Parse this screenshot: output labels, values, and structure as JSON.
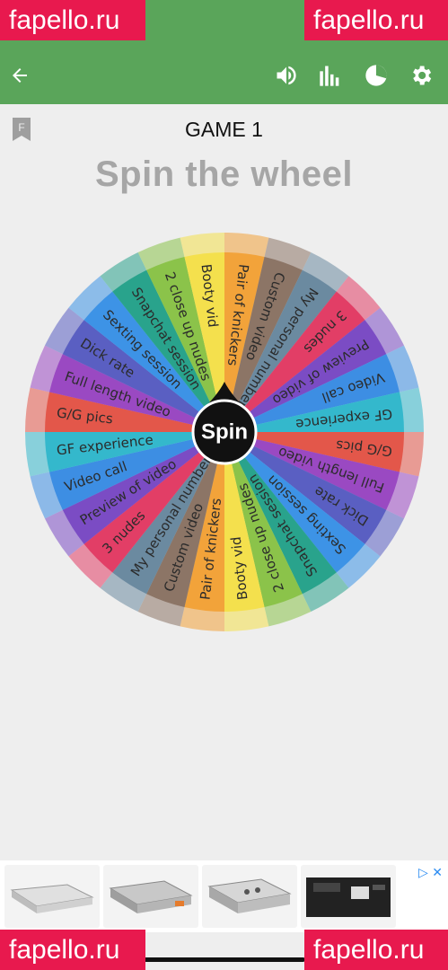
{
  "watermarks": {
    "text": "fapello.ru"
  },
  "toolbar": {
    "icons": [
      "back-arrow-icon",
      "speaker-icon",
      "bar-chart-icon",
      "pie-chart-icon",
      "gear-icon"
    ],
    "accent_color": "#5aa55a"
  },
  "game": {
    "title": "GAME 1",
    "heading": "Spin the wheel"
  },
  "wheel": {
    "center_label": "Spin",
    "segments": [
      {
        "label": "Pair of knickers",
        "color": "#f2a33a"
      },
      {
        "label": "Custom video",
        "color": "#8c7566"
      },
      {
        "label": "My personal number",
        "color": "#6b8aa0"
      },
      {
        "label": "3 nudes",
        "color": "#e23e66"
      },
      {
        "label": "Preview of video",
        "color": "#7b4cc4"
      },
      {
        "label": "Video call",
        "color": "#3d8ee3"
      },
      {
        "label": "GF experience",
        "color": "#34b8cc"
      },
      {
        "label": "G/G pics",
        "color": "#e3574a"
      },
      {
        "label": "Full length video",
        "color": "#9a49c2"
      },
      {
        "label": "Dick rate",
        "color": "#5a5fc2"
      },
      {
        "label": "Sexting session",
        "color": "#3d93e6"
      },
      {
        "label": "Snapchat session",
        "color": "#29a38c"
      },
      {
        "label": "2 close up nudes",
        "color": "#8bc34a"
      },
      {
        "label": "Booty vid",
        "color": "#f4e04d"
      },
      {
        "label": "Pair of knickers",
        "color": "#f2a33a"
      },
      {
        "label": "Custom video",
        "color": "#8c7566"
      },
      {
        "label": "My personal number",
        "color": "#6b8aa0"
      },
      {
        "label": "3 nudes",
        "color": "#e23e66"
      },
      {
        "label": "Preview of video",
        "color": "#7b4cc4"
      },
      {
        "label": "Video call",
        "color": "#3d8ee3"
      },
      {
        "label": "GF experience",
        "color": "#34b8cc"
      },
      {
        "label": "G/G pics",
        "color": "#e3574a"
      },
      {
        "label": "Full length video",
        "color": "#9a49c2"
      },
      {
        "label": "Dick rate",
        "color": "#5a5fc2"
      },
      {
        "label": "Sexting session",
        "color": "#3d93e6"
      },
      {
        "label": "Snapchat session",
        "color": "#29a38c"
      },
      {
        "label": "2 close up nudes",
        "color": "#8bc34a"
      },
      {
        "label": "Booty vid",
        "color": "#f4e04d"
      }
    ]
  },
  "ad": {
    "images": [
      "power-supply-image",
      "power-supply-image",
      "power-supply-image",
      "video-processor-image"
    ]
  }
}
